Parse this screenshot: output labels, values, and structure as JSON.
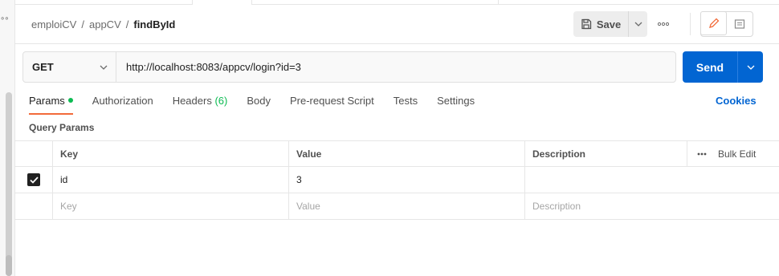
{
  "breadcrumb": {
    "collection": "emploiCV",
    "folder": "appCV",
    "request": "findById"
  },
  "toolbar": {
    "save_label": "Save",
    "more_icon": "more-horizontal-icon"
  },
  "request": {
    "method": "GET",
    "url": "http://localhost:8083/appcv/login?id=3",
    "send_label": "Send"
  },
  "tabs": [
    {
      "label": "Params",
      "active": true
    },
    {
      "label": "Authorization"
    },
    {
      "label": "Headers",
      "count": "(6)"
    },
    {
      "label": "Body"
    },
    {
      "label": "Pre-request Script"
    },
    {
      "label": "Tests"
    },
    {
      "label": "Settings"
    }
  ],
  "cookies_label": "Cookies",
  "query_params": {
    "title": "Query Params",
    "columns": {
      "key": "Key",
      "value": "Value",
      "description": "Description",
      "bulk_edit": "Bulk Edit"
    },
    "rows": [
      {
        "checked": true,
        "key": "id",
        "value": "3",
        "description": ""
      }
    ],
    "placeholder": {
      "key": "Key",
      "value": "Value",
      "description": "Description"
    }
  },
  "colors": {
    "accent": "#f26b3a",
    "send_blue": "#0265d2",
    "status_green": "#0cbb52"
  }
}
